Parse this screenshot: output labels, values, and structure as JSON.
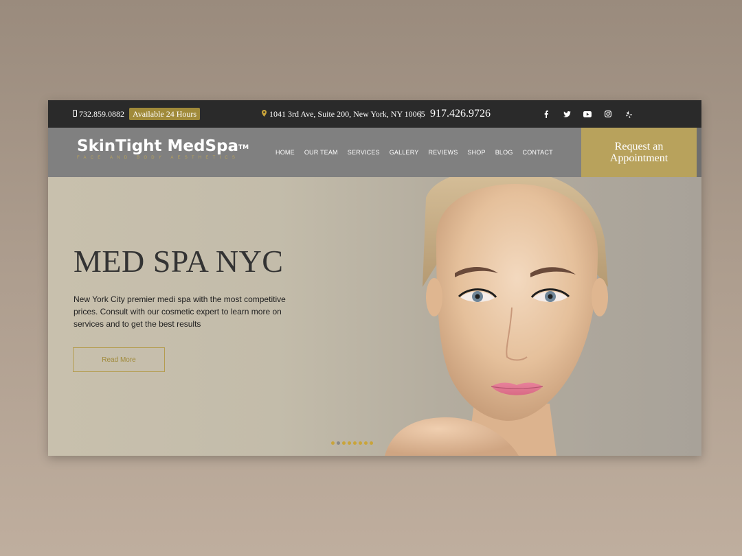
{
  "topbar": {
    "phone_left": "732.859.0882",
    "available": "Available 24 Hours",
    "address": "1041 3rd Ave, Suite 200, New York, NY 10065",
    "separator": "|",
    "phone_main": "917.426.9726",
    "social_icons": [
      "facebook-icon",
      "twitter-icon",
      "youtube-icon",
      "instagram-icon",
      "yelp-icon"
    ]
  },
  "nav": {
    "logo_title": "SkinTight MedSpa",
    "logo_tm": "TM",
    "logo_tagline": "FACE AND BODY AESTHETICS",
    "menu": [
      "HOME",
      "OUR TEAM",
      "SERVICES",
      "GALLERY",
      "REVIEWS",
      "SHOP",
      "BLOG",
      "CONTACT"
    ],
    "cta_line1": "Request an",
    "cta_line2": "Appointment"
  },
  "hero": {
    "title": "MED SPA NYC",
    "text": "New York City premier medi spa with the most competitive prices. Consult with our cosmetic expert to learn more on services and to get the best results",
    "button": "Read More",
    "slider": {
      "total": 8,
      "active": 2
    }
  },
  "colors": {
    "accent_gold": "#b8a25c",
    "topbar_bg": "#2a2a2a",
    "nav_bg": "#808080"
  }
}
